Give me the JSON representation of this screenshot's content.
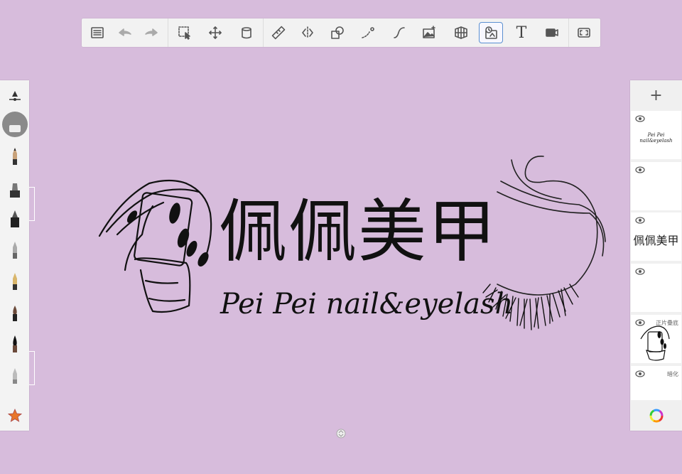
{
  "toolbar": {
    "items": [
      {
        "name": "menu-button",
        "icon": "list-icon"
      },
      {
        "name": "undo-button",
        "icon": "undo-arrow-icon"
      },
      {
        "name": "redo-button",
        "icon": "redo-arrow-icon"
      },
      {
        "name": "selection-button",
        "icon": "selection-icon"
      },
      {
        "name": "transform-button",
        "icon": "move-icon"
      },
      {
        "name": "fill-button",
        "icon": "bucket-icon"
      },
      {
        "name": "ruler-button",
        "icon": "ruler-icon"
      },
      {
        "name": "symmetry-button",
        "icon": "symmetry-icon"
      },
      {
        "name": "shapes-button",
        "icon": "shapes-icon"
      },
      {
        "name": "stroke-button",
        "icon": "stroke-icon"
      },
      {
        "name": "curve-button",
        "icon": "curve-icon"
      },
      {
        "name": "import-image-button",
        "icon": "image-icon"
      },
      {
        "name": "perspective-button",
        "icon": "perspective-grid-icon"
      },
      {
        "name": "time-lapse-button",
        "icon": "time-lapse-icon",
        "active": true
      },
      {
        "name": "text-button",
        "icon": "text-icon",
        "label": "T"
      },
      {
        "name": "record-button",
        "icon": "video-camera-icon"
      },
      {
        "name": "fullscreen-button",
        "icon": "fullscreen-icon"
      }
    ]
  },
  "canvas": {
    "title": "佩佩美甲",
    "subtitle": "Pei Pei nail&eyelash"
  },
  "layers": {
    "add_label": "+",
    "items": [
      {
        "name": "",
        "thumb": "Pei Pei nail&eyelash"
      },
      {
        "name": "",
        "thumb": ""
      },
      {
        "name": "",
        "thumb": "佩佩美甲"
      },
      {
        "name": "",
        "thumb": ""
      },
      {
        "name": "正片疊底",
        "thumb": ""
      },
      {
        "name": "暗化",
        "thumb": ""
      }
    ]
  },
  "colors": {
    "background": "#d7bcdc",
    "accent": "#5a8fd0",
    "star": "#e8762a"
  }
}
